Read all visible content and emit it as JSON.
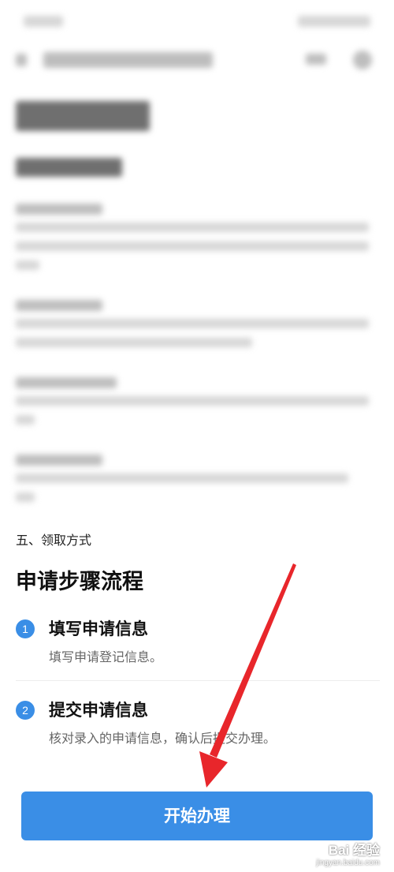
{
  "section_five_label": "五、领取方式",
  "steps_title": "申请步骤流程",
  "steps": [
    {
      "number": "1",
      "title": "填写申请信息",
      "desc": "填写申请登记信息。"
    },
    {
      "number": "2",
      "title": "提交申请信息",
      "desc": "核对录入的申请信息，确认后提交办理。"
    }
  ],
  "start_button": "开始办理",
  "watermark": {
    "main": "Bai 经验",
    "sub": "jingyan.baidu.com"
  },
  "colors": {
    "accent": "#3a8ee6",
    "arrow": "#e8262b"
  }
}
